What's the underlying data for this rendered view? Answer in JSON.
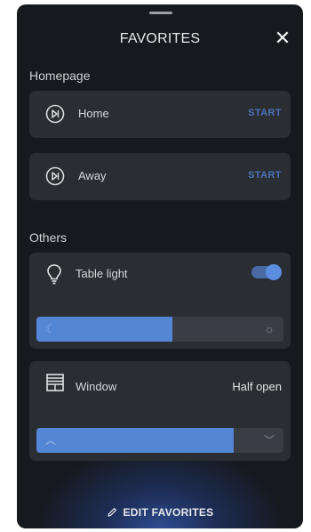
{
  "header": {
    "title": "FAVORITES",
    "close_icon": "close-icon"
  },
  "sections": {
    "homepage": "Homepage",
    "others": "Others"
  },
  "scenes": [
    {
      "label": "Home",
      "action": "START",
      "icon": "scene-play-icon"
    },
    {
      "label": "Away",
      "action": "START",
      "icon": "scene-play-icon"
    }
  ],
  "light": {
    "label": "Table light",
    "icon": "bulb-icon",
    "on": true,
    "brightness_fraction": 0.55,
    "slider_low_icon": "moon-icon",
    "slider_high_icon": "sun-icon"
  },
  "window": {
    "label": "Window",
    "state": "Half open",
    "icon": "window-blind-icon",
    "position_fraction": 0.8,
    "slider_up_icon": "chevron-up-icon",
    "slider_down_icon": "chevron-down-icon"
  },
  "footer": {
    "edit_label": "EDIT FAVORITES",
    "edit_icon": "pencil-icon"
  },
  "colors": {
    "accent": "#5486d6",
    "start_text": "#4b74b9",
    "card": "#2a2d32",
    "background": "#16191e"
  }
}
